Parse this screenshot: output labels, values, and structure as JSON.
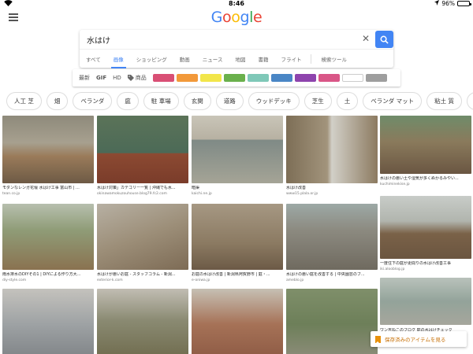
{
  "status": {
    "time": "8:46",
    "battery": "96%"
  },
  "logo": [
    "G",
    "o",
    "o",
    "g",
    "l",
    "e"
  ],
  "logo_colors": [
    "#4285f4",
    "#ea4335",
    "#fbbc05",
    "#4285f4",
    "#34a853",
    "#ea4335"
  ],
  "search": {
    "query": "水はけ"
  },
  "tabs": [
    "すべて",
    "画像",
    "ショッピング",
    "動画",
    "ニュース",
    "地図",
    "書籍",
    "フライト",
    "検索ツール"
  ],
  "filters": {
    "latest": "最新",
    "gif": "GIF",
    "hd": "HD",
    "products": "商品",
    "swatches": [
      "#d94f75",
      "#f2993a",
      "#f2e64a",
      "#6ab04c",
      "#7fc8b8",
      "#4a86c5",
      "#8e44ad",
      "#d95687",
      "#ffffff",
      "#9e9e9e"
    ]
  },
  "chips": [
    "人工 芝",
    "畑",
    "ベランダ",
    "庭",
    "駐 車場",
    "玄関",
    "道路",
    "ウッドデッキ",
    "芝生",
    "土",
    "ベランダ マット",
    "粘土 質",
    "プランター"
  ],
  "results": [
    {
      "cap": "モダンなレンガ花壇 水はけ工事 富山市 | ...",
      "src": "tean.co.jp",
      "img": "a"
    },
    {
      "cap": "水はけ対策」カテゴリー一覧 | 沖縄でも水... ",
      "src": "okinawamokuzouhouse.blog79.fc2.com",
      "img": "b"
    },
    {
      "cap": "暗渠",
      "src": "kaichi.ne.jp",
      "img": "c"
    },
    {
      "cap": "水はけ改善",
      "src": "www15.plala.or.jp",
      "img": "d"
    },
    {
      "cap": "水はけの悪い土や湿気が多くぬかるみやい...",
      "src": "kuchiminekise.jp",
      "img": "e"
    },
    {
      "cap": "雨水排水のDIYその1 | DIYによる作り方大...",
      "src": "diy-style.com",
      "img": "f"
    },
    {
      "cap": "水はけが悪いお庭 - スタッフコラム - 新潟...",
      "src": "exterior-k.com",
      "img": "g"
    },
    {
      "cap": "お庭の水はけ改善 | 新潟県阿賀野市 | 庭・...",
      "src": "e-oniwa.jp",
      "img": "h"
    },
    {
      "cap": "水はけの悪い庭を改善する | 中央園芸のブ...",
      "src": "ameblo.jp",
      "img": "i"
    },
    {
      "cap": "一度住下の庭が更間りの水はけ改善工事",
      "src": "iki.alooblog.jp",
      "img": "j"
    },
    {
      "cap": "",
      "src": "",
      "img": "k"
    },
    {
      "cap": "",
      "src": "",
      "img": "l"
    },
    {
      "cap": "",
      "src": "",
      "img": "m"
    },
    {
      "cap": "",
      "src": "",
      "img": "n"
    },
    {
      "cap": "",
      "src": "",
      "img": "o"
    },
    {
      "cap": "ワン吉ねこのブログ 庭の水はけチェック",
      "src": "",
      "img": "p"
    }
  ],
  "saved": {
    "label": "保存済みのアイテムを見る"
  }
}
